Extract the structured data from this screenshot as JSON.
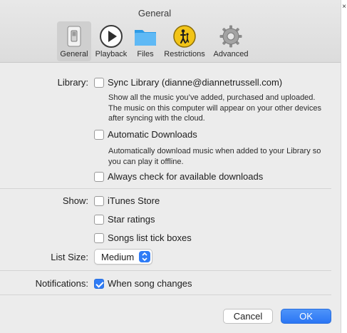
{
  "window": {
    "title": "General"
  },
  "tabs": [
    {
      "label": "General",
      "icon": "general-switch-icon",
      "selected": true
    },
    {
      "label": "Playback",
      "icon": "play-icon",
      "selected": false
    },
    {
      "label": "Files",
      "icon": "folder-icon",
      "selected": false
    },
    {
      "label": "Restrictions",
      "icon": "restrictions-icon",
      "selected": false
    },
    {
      "label": "Advanced",
      "icon": "gear-icon",
      "selected": false
    }
  ],
  "library": {
    "label": "Library:",
    "sync": {
      "label": "Sync Library (dianne@diannetrussell.com)",
      "checked": false,
      "help": "Show all the music you’ve added, purchased and uploaded. The music on this computer will appear on your other devices after syncing with the cloud."
    },
    "auto_downloads": {
      "label": "Automatic Downloads",
      "checked": false,
      "help": "Automatically download music when added to your Library so you can play it offline."
    },
    "check_downloads": {
      "label": "Always check for available downloads",
      "checked": false
    }
  },
  "show": {
    "label": "Show:",
    "itunes_store": {
      "label": "iTunes Store",
      "checked": false
    },
    "star_ratings": {
      "label": "Star ratings",
      "checked": false
    },
    "tick_boxes": {
      "label": "Songs list tick boxes",
      "checked": false
    }
  },
  "list_size": {
    "label": "List Size:",
    "value": "Medium"
  },
  "notifications": {
    "label": "Notifications:",
    "song_changes": {
      "label": "When song changes",
      "checked": true
    }
  },
  "buttons": {
    "cancel": "Cancel",
    "ok": "OK"
  },
  "colors": {
    "accent": "#2f7cf6",
    "window_bg": "#ececec",
    "toolbar_bg": "#dcdcdc"
  }
}
